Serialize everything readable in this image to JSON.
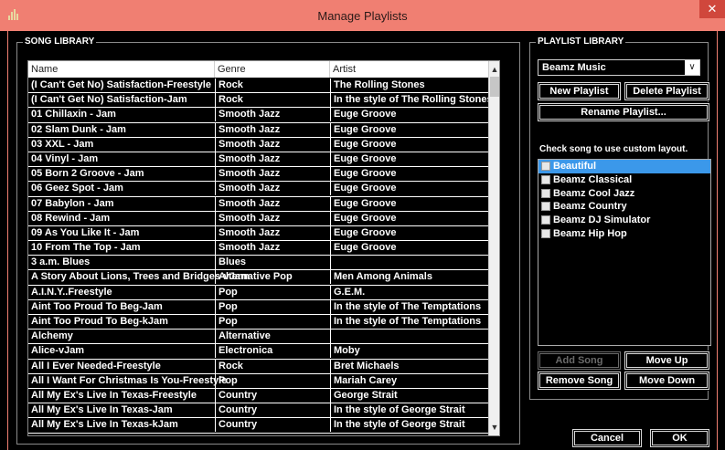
{
  "window": {
    "title": "Manage Playlists",
    "close_glyph": "✕"
  },
  "song_library": {
    "label": "SONG LIBRARY",
    "columns": [
      "Name",
      "Genre",
      "Artist"
    ],
    "rows": [
      {
        "name": "(I Can't Get No) Satisfaction-Freestyle",
        "genre": "Rock",
        "artist": "The Rolling Stones"
      },
      {
        "name": "(I Can't Get No) Satisfaction-Jam",
        "genre": "Rock",
        "artist": "In the style of The Rolling Stones"
      },
      {
        "name": "01 Chillaxin - Jam",
        "genre": "Smooth Jazz",
        "artist": "Euge Groove"
      },
      {
        "name": "02 Slam Dunk - Jam",
        "genre": "Smooth Jazz",
        "artist": "Euge Groove"
      },
      {
        "name": "03 XXL - Jam",
        "genre": "Smooth Jazz",
        "artist": "Euge Groove"
      },
      {
        "name": "04 Vinyl - Jam",
        "genre": "Smooth Jazz",
        "artist": "Euge Groove"
      },
      {
        "name": "05 Born 2 Groove - Jam",
        "genre": "Smooth Jazz",
        "artist": "Euge Groove"
      },
      {
        "name": "06 Geez Spot - Jam",
        "genre": "Smooth Jazz",
        "artist": "Euge Groove"
      },
      {
        "name": "07 Babylon - Jam",
        "genre": "Smooth Jazz",
        "artist": "Euge Groove"
      },
      {
        "name": "08 Rewind - Jam",
        "genre": "Smooth Jazz",
        "artist": "Euge Groove"
      },
      {
        "name": "09 As You Like It - Jam",
        "genre": "Smooth Jazz",
        "artist": "Euge Groove"
      },
      {
        "name": "10 From The Top - Jam",
        "genre": "Smooth Jazz",
        "artist": "Euge Groove"
      },
      {
        "name": "3 a.m. Blues",
        "genre": "Blues",
        "artist": ""
      },
      {
        "name": "A Story About Lions, Trees and Bridges-vJam",
        "genre": "Alternative Pop",
        "artist": "Men Among Animals"
      },
      {
        "name": "A.I.N.Y..Freestyle",
        "genre": "Pop",
        "artist": "G.E.M."
      },
      {
        "name": "Aint Too Proud To Beg-Jam",
        "genre": "Pop",
        "artist": "In the style of The Temptations"
      },
      {
        "name": "Aint Too Proud To Beg-kJam",
        "genre": "Pop",
        "artist": "In the style of The Temptations"
      },
      {
        "name": "Alchemy",
        "genre": "Alternative",
        "artist": ""
      },
      {
        "name": "Alice-vJam",
        "genre": "Electronica",
        "artist": "Moby"
      },
      {
        "name": "All I Ever Needed-Freestyle",
        "genre": "Rock",
        "artist": "Bret Michaels"
      },
      {
        "name": "All I Want For Christmas Is You-Freestyle",
        "genre": "Pop",
        "artist": "Mariah Carey"
      },
      {
        "name": "All My Ex's Live In Texas-Freestyle",
        "genre": "Country",
        "artist": "George Strait"
      },
      {
        "name": "All My Ex's Live In Texas-Jam",
        "genre": "Country",
        "artist": "In the style of George Strait"
      },
      {
        "name": "All My Ex's Live In Texas-kJam",
        "genre": "Country",
        "artist": "In the style of George Strait"
      }
    ]
  },
  "playlist_library": {
    "label": "PLAYLIST LIBRARY",
    "selected_playlist": "Beamz Music",
    "new_playlist": "New Playlist",
    "delete_playlist": "Delete Playlist",
    "rename_playlist": "Rename Playlist...",
    "hint": "Check song to use custom layout.",
    "layouts": [
      {
        "label": "Beautiful",
        "selected": true
      },
      {
        "label": "Beamz Classical",
        "selected": false
      },
      {
        "label": "Beamz Cool Jazz",
        "selected": false
      },
      {
        "label": "Beamz Country",
        "selected": false
      },
      {
        "label": "Beamz DJ Simulator",
        "selected": false
      },
      {
        "label": "Beamz Hip Hop",
        "selected": false
      }
    ],
    "add_song": "Add Song",
    "move_up": "Move Up",
    "remove_song": "Remove Song",
    "move_down": "Move Down"
  },
  "footer": {
    "cancel": "Cancel",
    "ok": "OK"
  },
  "colors": {
    "titlebar": "#f07f72",
    "close": "#d0473c",
    "selection": "#3b98ea"
  }
}
